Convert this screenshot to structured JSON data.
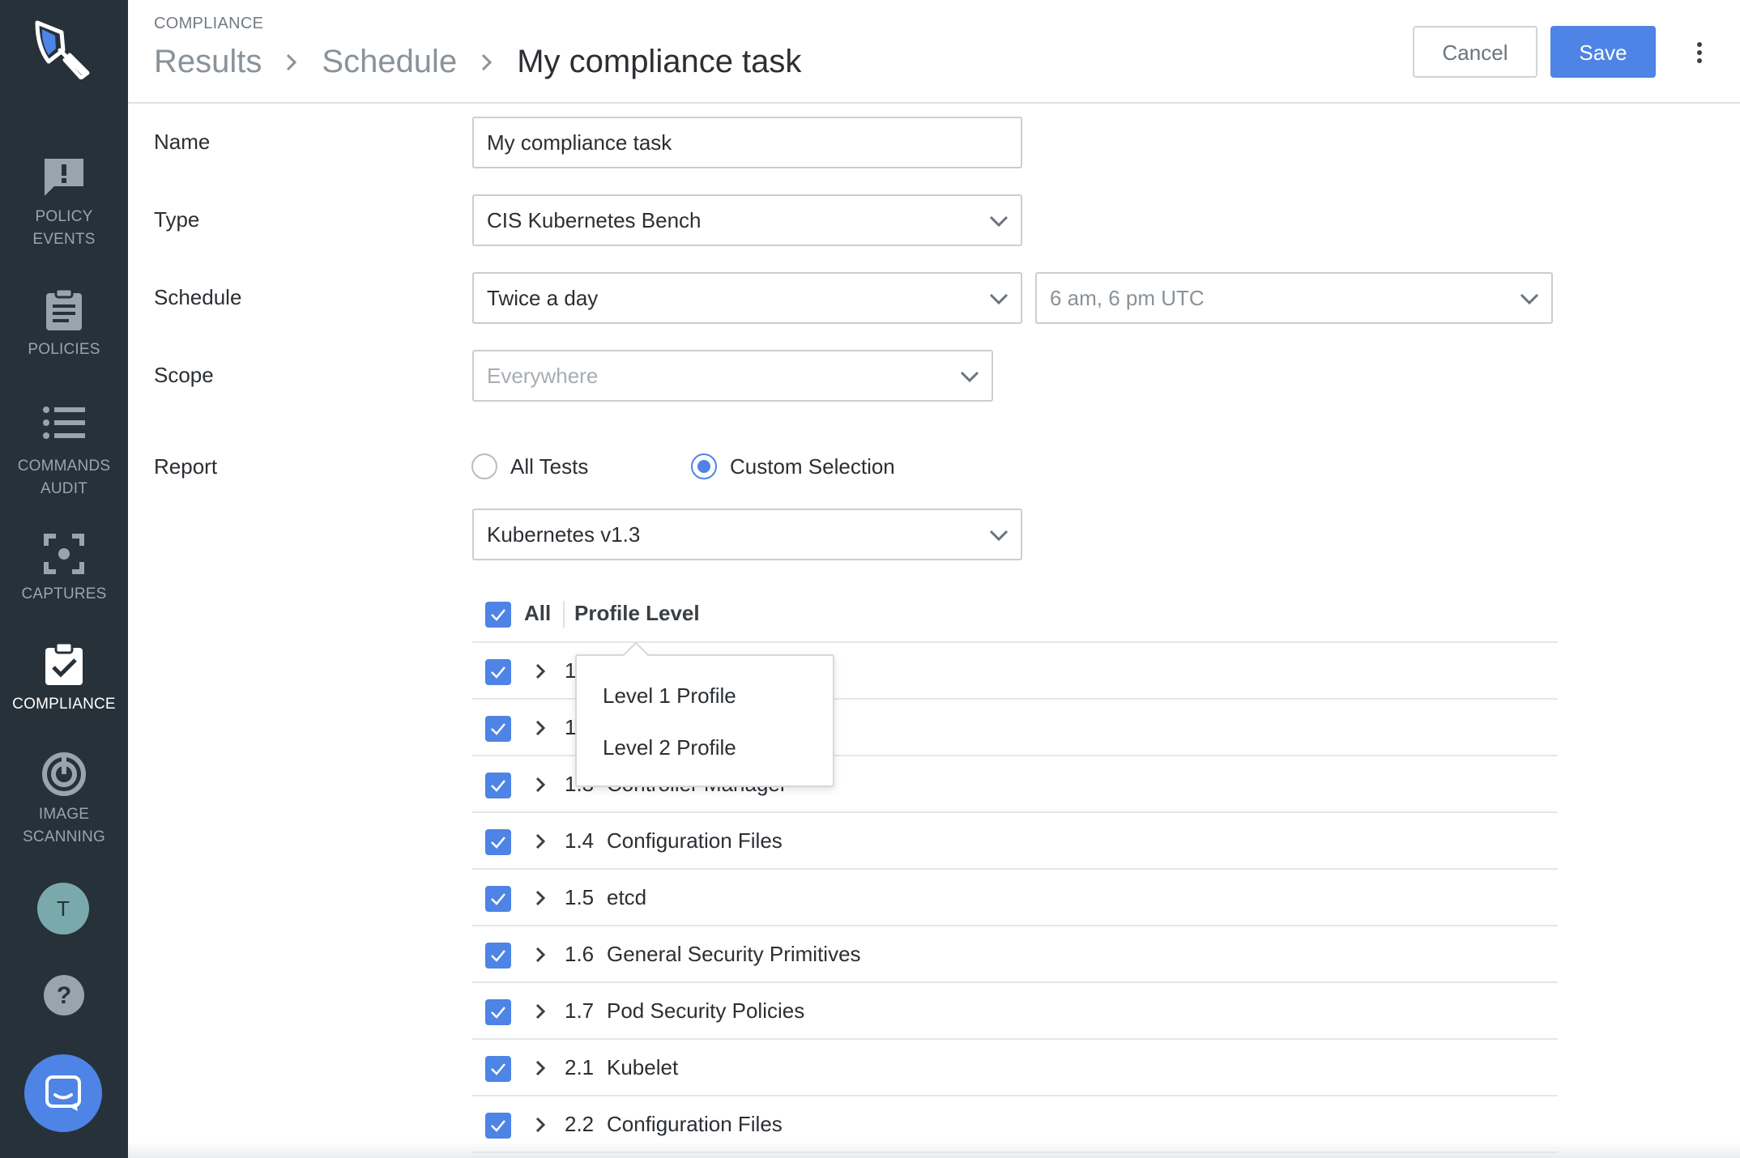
{
  "colors": {
    "sidebar_bg": "#26313a",
    "accent": "#4d84e5",
    "sidebar_text": "#9aa4ad",
    "sidebar_active_text": "#ffffff"
  },
  "sidebar": {
    "items": [
      {
        "icon": "policy-events-icon",
        "line1": "POLICY",
        "line2": "EVENTS",
        "active": false
      },
      {
        "icon": "policies-icon",
        "line1": "POLICIES",
        "line2": "",
        "active": false
      },
      {
        "icon": "commands-audit-icon",
        "line1": "COMMANDS",
        "line2": "AUDIT",
        "active": false
      },
      {
        "icon": "captures-icon",
        "line1": "CAPTURES",
        "line2": "",
        "active": false
      },
      {
        "icon": "compliance-icon",
        "line1": "COMPLIANCE",
        "line2": "",
        "active": true
      },
      {
        "icon": "image-scanning-icon",
        "line1": "IMAGE",
        "line2": "SCANNING",
        "active": false
      }
    ],
    "avatar_initial": "T"
  },
  "header": {
    "section": "COMPLIANCE",
    "breadcrumb": [
      "Results",
      "Schedule",
      "My compliance task"
    ],
    "cancel_label": "Cancel",
    "save_label": "Save"
  },
  "form": {
    "name": {
      "label": "Name",
      "value": "My compliance task"
    },
    "type": {
      "label": "Type",
      "value": "CIS Kubernetes Bench"
    },
    "schedule": {
      "label": "Schedule",
      "frequency": "Twice a day",
      "time": "6 am, 6 pm UTC"
    },
    "scope": {
      "label": "Scope",
      "placeholder": "Everywhere"
    },
    "report": {
      "label": "Report",
      "options": [
        "All Tests",
        "Custom Selection"
      ],
      "selected": "Custom Selection",
      "version": "Kubernetes v1.3"
    }
  },
  "table": {
    "all_label": "All",
    "profile_level_label": "Profile Level",
    "rows": [
      {
        "num": "1",
        "name": "",
        "checked": true
      },
      {
        "num": "1",
        "name": "",
        "checked": true
      },
      {
        "num": "1.3",
        "name": "Controller Manager",
        "checked": true
      },
      {
        "num": "1.4",
        "name": "Configuration Files",
        "checked": true
      },
      {
        "num": "1.5",
        "name": "etcd",
        "checked": true
      },
      {
        "num": "1.6",
        "name": "General Security Primitives",
        "checked": true
      },
      {
        "num": "1.7",
        "name": "Pod Security Policies",
        "checked": true
      },
      {
        "num": "2.1",
        "name": "Kubelet",
        "checked": true
      },
      {
        "num": "2.2",
        "name": "Configuration Files",
        "checked": true
      }
    ]
  },
  "profile_dropdown": {
    "options": [
      "Level 1 Profile",
      "Level 2 Profile"
    ]
  }
}
